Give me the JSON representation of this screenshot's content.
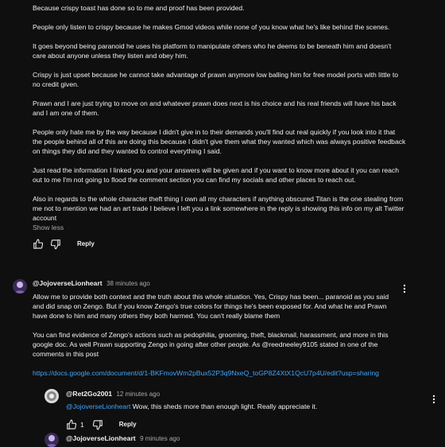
{
  "top_comment": {
    "paragraphs": [
      "Because crispy toast has done so to me and proof has been provided.",
      "People only listen to crispy because he makes Gmod videos while none of you know what he's like behind the scenes.",
      "It goes beyond being paranoid he uses his platform to manipulate others who he deems to be beneath him and doesn't care about anyone unless they listen and obey him.",
      "Crispy is just upset because he cannot take advantage of prawn anymore low balling him for free model ports with little to no credit given.",
      "Prawn and I are just trying to move on and whatever prawn does next is his choice and his real friends will have his back and I am one of them.",
      "People only hate me by the way because I didn't give in to their demands you'll find out real quickly if you look into it that the people behind all of this are doing this because I didn't give them what they wanted which was always positive feedback on things they did and they wanted to control everything I said.",
      "Just read the information I linked you and your answers will be given and if you want to know more about it you can reach out to me I'm not going to flood the comment section you can find my socials and other places to reach out.",
      "Also in regards to the whole character theft thing I own all my characters if anything obscured Titan is the one stealing from me not to mention we had an art trade I believe I left you a link somewhere in the reply is showing this info on my alt Twitter account"
    ],
    "show_less": "Show less",
    "reply_label": "Reply"
  },
  "reply1": {
    "author": "@JojoverseLionheart",
    "time": "38 minutes ago",
    "paragraph1": "Allow me to provide both context and the truth about this whole situation. Yes, Crispy has been... paranoid as you said and did snap on Zengo. But if you know Zengo's true colors for things he's been exposed for. And what he and Prawn have done to him and many others they both harmed. You can't really blame them",
    "paragraph2": "You can find evidence of Zengo's actions such as pedophilia, grooming, theft, blackmail, harassment, and more in this google doc. As well Prawn supporting Zengo in going after other people. As @reedneeley9105 stated in one of the comments in this post",
    "link": "https://docs.google.com/document/d/1-BKFmovWm2pBux52P3q9NxeQ_toGP8Z4XtX1QcU7p4U/edit?usp=sharing"
  },
  "reply2": {
    "author": "@Ret2Go2001",
    "time": "12 minutes ago",
    "mention": "@JojoverseLionheart",
    "text": " Wow, this sheds more than enough light. Really appreciate it.",
    "like_count": "1",
    "reply_label": "Reply"
  },
  "reply3": {
    "author": "@JojoverseLionheart",
    "time": "9 minutes ago"
  },
  "icons": {
    "like": "thumbs-up-icon",
    "dislike": "thumbs-down-icon",
    "menu": "vertical-dots-icon"
  }
}
